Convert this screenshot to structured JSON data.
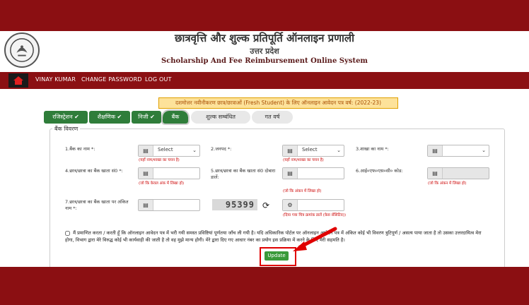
{
  "header": {
    "title_hi": "छात्रवृत्ति और शुल्क प्रतिपूर्ति ऑनलाइन प्रणाली",
    "state": "उत्तर प्रदेश",
    "title_en": "Scholarship And Fee Reimbursement Online System"
  },
  "nav": {
    "items": [
      {
        "label": "VINAY KUMAR"
      },
      {
        "label": "CHANGE PASSWORD"
      },
      {
        "label": "LOG OUT"
      }
    ]
  },
  "banner": {
    "text": "दशमोत्तर नवीनीकरण छात्र/छात्राओं (Fresh Student) के लिए ऑनलाइन आवेदन पत्र वर्ष: (2022-23)"
  },
  "tabs": [
    {
      "label": "रजिस्ट्रेशन ✔"
    },
    {
      "label": "शैक्षणिक ✔"
    },
    {
      "label": "निजी ✔"
    },
    {
      "label": "बैंक"
    },
    {
      "label": "शुल्क सम्बंधित"
    },
    {
      "label": "गत वर्ष"
    }
  ],
  "form": {
    "legend": "बैंक विवरण",
    "fields": {
      "bank_name_label": "1.बैंक का नाम *:",
      "bank_name_value": "Select",
      "bank_name_hint": "(यहाँ नाम/शाखा का चयन है)",
      "district_label": "2.जनपद *:",
      "district_value": "Select",
      "district_hint": "(यहाँ नाम/शाखा का चयन है)",
      "branch_label": "3.शाखा का नाम *:",
      "account_label": "4.छात्र/छात्रा का बैंक खाता सं0 *:",
      "account_hint": "(जो कि केवल अंक में लिखा हो)",
      "account_repeat_label": "5.छात्र/छात्रा का बैंक खाता सं0 दोबारा डालें:",
      "account_repeat_hint": "(जो कि अंकन में लिखा हो)",
      "ifsc_label": "6.आई०एफ०एस०सी० कोड:",
      "ifsc_hint": "(जो कि अंकन में लिखा हो)",
      "holder_label": "7.छात्र/छात्रा का बैंक खाता पर अंकित नाम *:",
      "captcha_value": "95399",
      "captcha_hint": "(दिया गया चित्र क्रमांक डालें (केस सेंसिटिव))"
    },
    "declaration": "मैं प्रमाणित करता / करती हूँ कि ऑनलाइन आवेदन पत्र में भरी गयी समस्त प्रविष्टियां पूर्णतया जाँच ली गयी है। यदि अधिकारिक पोर्टल पर ऑनलाइन आवेदन पत्र में अंकित कोई भी विवरण त्रुटिपूर्ण / असत्य पाया जाता है तो उसका उत्तरदायित्व मेरा होगा, विभाग द्वारा मेरे विरुद्ध कोई भी कार्यवाही की जाती है तो वह मुझे मान्य होगी। मेरे द्वारा दिए गए आधार नंबर का प्रयोग इस प्रक्रिया में करने के लिए मेरी सहमति है।",
    "update_label": "Update"
  },
  "colors": {
    "background": "#8b0f12",
    "nav": "#8b1013",
    "tab_green": "#2f7d3a",
    "banner_bg": "#fde29a",
    "highlight": "#e00000"
  }
}
